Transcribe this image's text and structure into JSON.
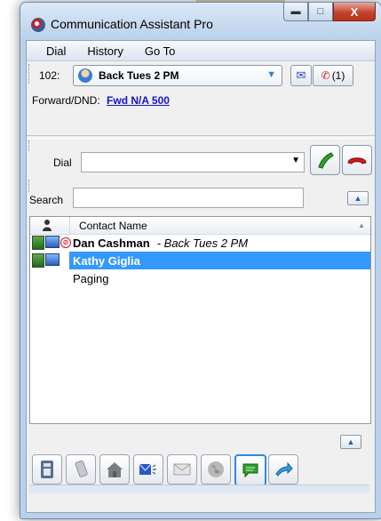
{
  "window": {
    "title": "Communication Assistant Pro"
  },
  "menu": {
    "items": [
      "Dial",
      "History",
      "Go To"
    ]
  },
  "extension": {
    "label": "102:"
  },
  "status": {
    "selected": "Back Tues 2 PM"
  },
  "missed_calls": {
    "label": "(1)"
  },
  "forward": {
    "label": "Forward/DND:",
    "link": "Fwd N/A 500"
  },
  "dial": {
    "label": "Dial",
    "value": ""
  },
  "search": {
    "label": "Search",
    "value": ""
  },
  "contacts": {
    "column_header": "Contact Name",
    "rows": [
      {
        "name": "Dan Cashman",
        "status": "- Back Tues 2 PM"
      },
      {
        "name": "Kathy Giglia",
        "status": ""
      },
      {
        "name": "Paging",
        "status": ""
      }
    ]
  },
  "icons": {
    "app": "app-logo-icon",
    "status": "user-status-icon",
    "voicemail": "voicemail-icon",
    "missed": "missed-call-icon",
    "call": "call-icon",
    "hangup": "hang-up-icon"
  },
  "colors": {
    "selection": "#3399ff",
    "link": "#1414c8",
    "call_green": "#2ea12e",
    "hangup_red": "#d11a1a"
  }
}
